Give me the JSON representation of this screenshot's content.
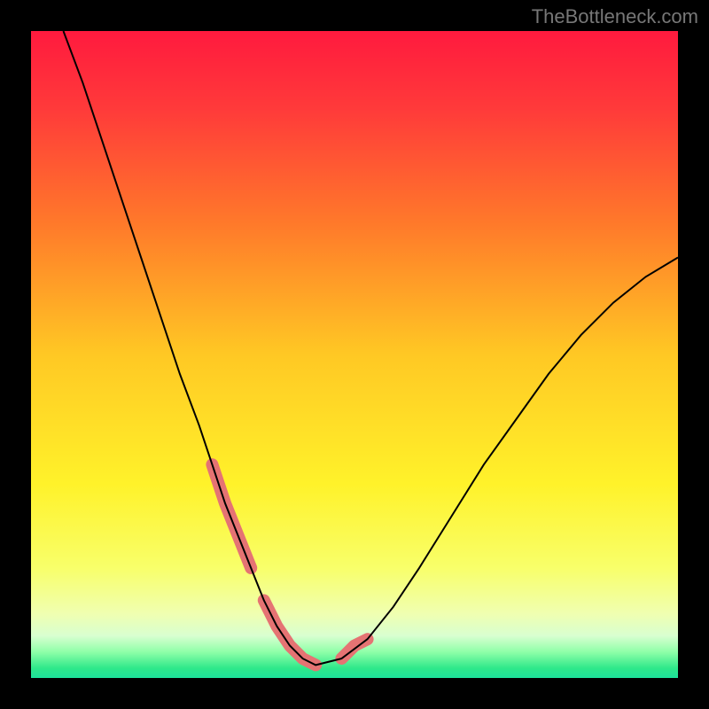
{
  "watermark": "TheBottleneck.com",
  "chart_data": {
    "type": "line",
    "title": "",
    "xlabel": "",
    "ylabel": "",
    "xlim": [
      0,
      100
    ],
    "ylim": [
      0,
      100
    ],
    "background_gradient": {
      "stops": [
        {
          "offset": 0.0,
          "color": "#ff1a3e"
        },
        {
          "offset": 0.12,
          "color": "#ff3a3a"
        },
        {
          "offset": 0.3,
          "color": "#ff7a2a"
        },
        {
          "offset": 0.5,
          "color": "#ffc824"
        },
        {
          "offset": 0.7,
          "color": "#fff22a"
        },
        {
          "offset": 0.83,
          "color": "#f8ff6a"
        },
        {
          "offset": 0.9,
          "color": "#f0ffb0"
        },
        {
          "offset": 0.935,
          "color": "#d8ffd0"
        },
        {
          "offset": 0.96,
          "color": "#8effa8"
        },
        {
          "offset": 0.985,
          "color": "#2ee88a"
        },
        {
          "offset": 1.0,
          "color": "#1de29b"
        }
      ]
    },
    "series": [
      {
        "name": "bottleneck-curve",
        "color": "#000000",
        "stroke_width": 2,
        "x": [
          5,
          8,
          11,
          14,
          17,
          20,
          23,
          26,
          28,
          30,
          32,
          34,
          36,
          38,
          40,
          42,
          44,
          48,
          52,
          56,
          60,
          65,
          70,
          75,
          80,
          85,
          90,
          95,
          100
        ],
        "y": [
          100,
          92,
          83,
          74,
          65,
          56,
          47,
          39,
          33,
          27,
          22,
          17,
          12,
          8,
          5,
          3,
          2,
          3,
          6,
          11,
          17,
          25,
          33,
          40,
          47,
          53,
          58,
          62,
          65
        ]
      }
    ],
    "highlight_segments": [
      {
        "name": "left-highlight",
        "color": "#e57373",
        "stroke_width": 14,
        "x": [
          28,
          30,
          32,
          34
        ],
        "y": [
          33,
          27,
          22,
          17
        ]
      },
      {
        "name": "bottom-highlight",
        "color": "#e57373",
        "stroke_width": 14,
        "x": [
          36,
          38,
          40,
          42,
          44
        ],
        "y": [
          12,
          8,
          5,
          3,
          2
        ]
      },
      {
        "name": "right-highlight",
        "color": "#e57373",
        "stroke_width": 14,
        "x": [
          48,
          50,
          52
        ],
        "y": [
          3,
          5,
          6
        ]
      }
    ]
  }
}
